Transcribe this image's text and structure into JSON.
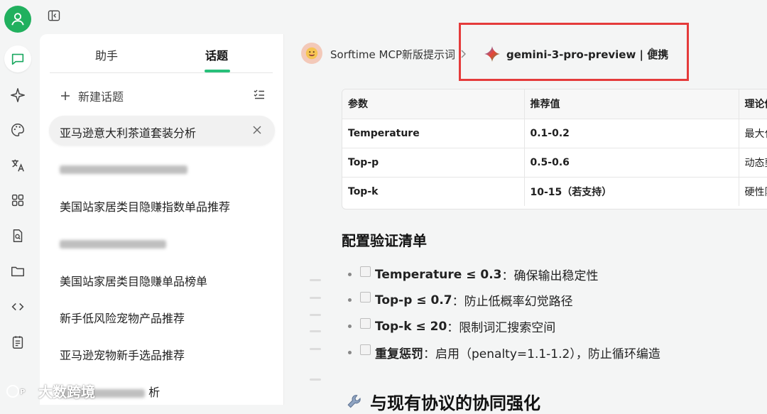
{
  "sidebar_tabs": {
    "assistant": "助手",
    "topics": "话题"
  },
  "new_topic": "新建话题",
  "topics": [
    "亚马逊意大利茶道套装分析",
    "美国站家居类目隐赚指数单品推荐",
    "美国站家居类目隐赚单品榜单",
    "新手低风险宠物产品推荐",
    "亚马逊宠物新手选品推荐"
  ],
  "blurred_topic_suffix": "析",
  "header": {
    "assistant_name": "Sorftime MCP新版提示词",
    "model_name": "gemini-3-pro-preview | 便携"
  },
  "table": {
    "headers": [
      "参数",
      "推荐值",
      "理论依"
    ],
    "rows": [
      [
        "Temperature",
        "0.1-0.2",
        "最大化"
      ],
      [
        "Top-p",
        "0.5-0.6",
        "动态剪"
      ],
      [
        "Top-k",
        "10-15（若支持）",
        "硬性限"
      ]
    ]
  },
  "checklist_title": "配置验证清单",
  "checklist": [
    {
      "strong": "Temperature ≤ 0.3",
      "text": "：确保输出稳定性"
    },
    {
      "strong": "Top-p ≤ 0.7",
      "text": "：防止低概率幻觉路径"
    },
    {
      "strong": "Top-k ≤ 20",
      "text": "：限制词汇搜索空间"
    },
    {
      "strong": "重复惩罚",
      "text": "：启用（penalty=1.1-1.2），防止循环编造"
    }
  ],
  "section_heading": "与现有协议的协同强化",
  "watermark": "大数跨境",
  "colors": {
    "accent": "#27c07a",
    "highlight_box": "#e53b3b"
  }
}
